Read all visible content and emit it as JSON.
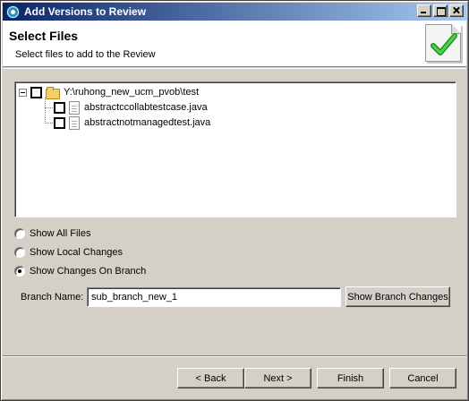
{
  "window": {
    "title": "Add Versions to Review",
    "controls": [
      "minimize",
      "maximize",
      "close"
    ]
  },
  "header": {
    "title": "Select Files",
    "description": "Select files to add to the Review",
    "graphic_icon": "checkmark-document-icon"
  },
  "tree": {
    "root": {
      "label": "Y:\\ruhong_new_ucm_pvob\\test",
      "expanded": true,
      "checked": false,
      "icon": "folder-icon"
    },
    "files": [
      {
        "label": "abstractccollabtestcase.java",
        "checked": false,
        "icon": "file-icon"
      },
      {
        "label": "abstractnotmanagedtest.java",
        "checked": false,
        "icon": "file-icon"
      }
    ]
  },
  "filter_options": [
    {
      "label": "Show All Files",
      "selected": false
    },
    {
      "label": "Show Local Changes",
      "selected": false
    },
    {
      "label": "Show Changes On Branch",
      "selected": true
    }
  ],
  "branch": {
    "label": "Branch Name:",
    "value": "sub_branch_new_1",
    "button_label": "Show Branch Changes"
  },
  "footer": {
    "back_label": "< Back",
    "next_label": "Next >",
    "finish_label": "Finish",
    "cancel_label": "Cancel"
  },
  "colors": {
    "titlebar_start": "#0a246a",
    "titlebar_end": "#a6caf0",
    "dialog_face": "#d4d0c8",
    "checkmark": "#2eaa2e"
  }
}
